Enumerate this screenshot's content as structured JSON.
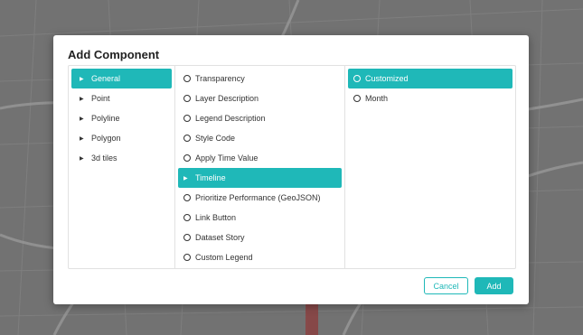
{
  "dialog": {
    "title": "Add Component",
    "cancel_label": "Cancel",
    "add_label": "Add"
  },
  "categories": [
    {
      "label": "General",
      "selected": true
    },
    {
      "label": "Point",
      "selected": false
    },
    {
      "label": "Polyline",
      "selected": false
    },
    {
      "label": "Polygon",
      "selected": false
    },
    {
      "label": "3d tiles",
      "selected": false
    }
  ],
  "components": [
    {
      "label": "Transparency",
      "kind": "radio"
    },
    {
      "label": "Layer Description",
      "kind": "radio"
    },
    {
      "label": "Legend Description",
      "kind": "radio"
    },
    {
      "label": "Style Code",
      "kind": "radio"
    },
    {
      "label": "Apply Time Value",
      "kind": "radio"
    },
    {
      "label": "Timeline",
      "kind": "group",
      "selected": true
    },
    {
      "label": "Prioritize Performance (GeoJSON)",
      "kind": "radio"
    },
    {
      "label": "Link Button",
      "kind": "radio"
    },
    {
      "label": "Dataset Story",
      "kind": "radio"
    },
    {
      "label": "Custom Legend",
      "kind": "radio"
    }
  ],
  "options": [
    {
      "label": "Customized",
      "selected": true
    },
    {
      "label": "Month",
      "selected": false
    }
  ],
  "colors": {
    "accent": "#1fb8b8"
  }
}
